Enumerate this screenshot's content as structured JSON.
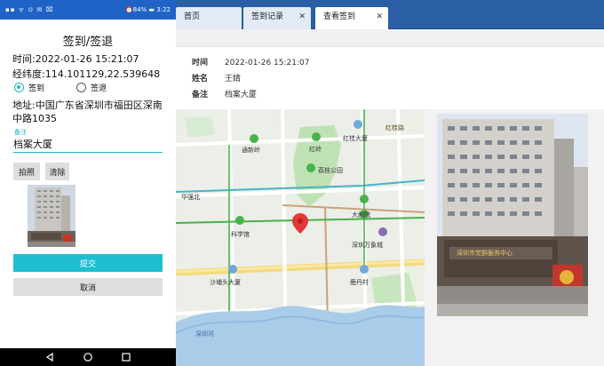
{
  "status_bar": {
    "left_icons": "▪▪ ᯤ ⊙ ✉ ⌧",
    "right_text": "⏰84% ▬ 3:22"
  },
  "phone": {
    "title": "签到/签退",
    "time_line": "时间:2022-01-26 15:21:07",
    "coords_line": "经纬度:114.101129,22.539648",
    "radio_checkin": "签到",
    "radio_checkout": "签退",
    "address_line": "地址:中国广东省深圳市福田区深南中路1035",
    "note_caption": "备注",
    "note_value": "档案大厦",
    "photo_button": "拍照",
    "clear_button": "清除",
    "submit_button": "提交",
    "cancel_button": "取消"
  },
  "web": {
    "tabs": [
      {
        "label": "首页"
      },
      {
        "label": "签到记录"
      },
      {
        "label": "查看签到"
      }
    ],
    "close_glyph": "✕",
    "info": {
      "time_label": "时间",
      "time_value": "2022-01-26 15:21:07",
      "name_label": "姓名",
      "name_value": "王婧",
      "note_label": "备注",
      "note_value": "档案大厦"
    },
    "map_labels": {
      "tonxinling": "通新岭",
      "hongling": "红岭",
      "honggui": "红桂大厦",
      "honggui_road": "红桂路",
      "lizhi_park": "荔枝公园",
      "huaqiangbei": "华强北",
      "da_ju_yuan": "大剧院",
      "kexue_guan": "科学馆",
      "mixc": "深圳万象城",
      "shatou": "沙埔头大厦",
      "lu_dan": "鹿丹村",
      "river": "深圳河"
    },
    "photo_sign": "深圳市党群服务中心"
  },
  "colors": {
    "status_blue": "#1e63c5",
    "tabbar_blue": "#2a5fa4",
    "accent_teal": "#1ebed0",
    "metro_green": "#49b24a",
    "map_marker": "#e53935"
  }
}
